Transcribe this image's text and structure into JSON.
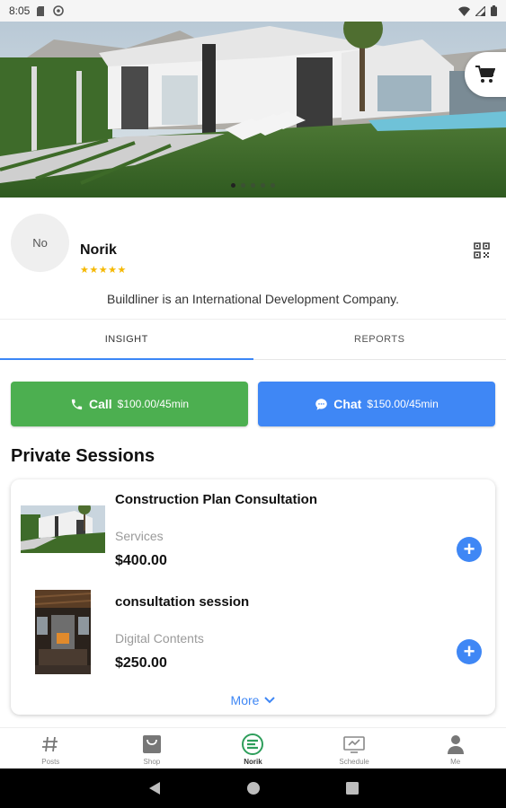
{
  "status_bar": {
    "time": "8:05"
  },
  "hero": {
    "carousel_dots": 5,
    "active_dot": 0
  },
  "profile": {
    "avatar_initials": "No",
    "name": "Norik",
    "rating": "★★★★★",
    "bio": "Buildliner is an International Development Company."
  },
  "tabs": [
    {
      "label": "INSIGHT",
      "active": true
    },
    {
      "label": "REPORTS",
      "active": false
    }
  ],
  "actions": {
    "call": {
      "label": "Call",
      "price": "$100.00/45min"
    },
    "chat": {
      "label": "Chat",
      "price": "$150.00/45min"
    }
  },
  "private_sessions": {
    "title": "Private Sessions",
    "items": [
      {
        "title": "Construction Plan Consultation",
        "category": "Services",
        "price": "$400.00",
        "thumb_icon": "house-exterior-thumbnail"
      },
      {
        "title": "consultation session",
        "category": "Digital Contents",
        "price": "$250.00",
        "thumb_icon": "interior-room-thumbnail"
      }
    ],
    "more_label": "More"
  },
  "bottom_nav": [
    {
      "label": "Posts",
      "icon": "hash-icon",
      "active": false
    },
    {
      "label": "Shop",
      "icon": "shop-bag-icon",
      "active": false
    },
    {
      "label": "Norik",
      "icon": "brand-logo-icon",
      "active": true
    },
    {
      "label": "Schedule",
      "icon": "schedule-icon",
      "active": false
    },
    {
      "label": "Me",
      "icon": "person-icon",
      "active": false
    }
  ],
  "colors": {
    "call_green": "#4caf50",
    "chat_blue": "#3f87f5",
    "accent_blue": "#3b86f6",
    "star_gold": "#f5b800",
    "brand_green": "#2e9e5b"
  }
}
